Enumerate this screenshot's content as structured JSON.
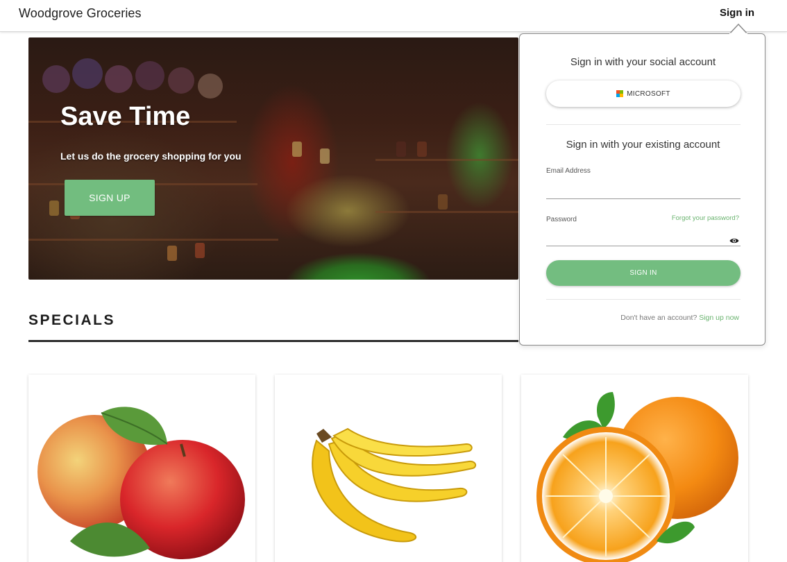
{
  "header": {
    "brand": "Woodgrove Groceries",
    "sign_in_label": "Sign in"
  },
  "hero": {
    "title": "Save Time",
    "subtitle": "Let us do the grocery shopping for you",
    "button_label": "SIGN UP"
  },
  "specials": {
    "title": "SPECIALS",
    "cards": [
      {
        "icon": "apple-image"
      },
      {
        "icon": "banana-image"
      },
      {
        "icon": "orange-image"
      }
    ]
  },
  "signin_popover": {
    "social_heading": "Sign in with your social account",
    "microsoft_label": "MICROSOFT",
    "existing_heading": "Sign in with your existing account",
    "email_label": "Email Address",
    "email_value": "",
    "password_label": "Password",
    "password_value": "",
    "forgot_label": "Forgot your password?",
    "sign_in_button": "SIGN IN",
    "no_account_text": "Don't have an account?",
    "sign_up_link": "Sign up now"
  },
  "colors": {
    "accent_green": "#73bd80",
    "link_green": "#6ab36f",
    "ms_red": "#f25022",
    "ms_green": "#7fba00",
    "ms_blue": "#00a4ef",
    "ms_yellow": "#ffb900"
  }
}
